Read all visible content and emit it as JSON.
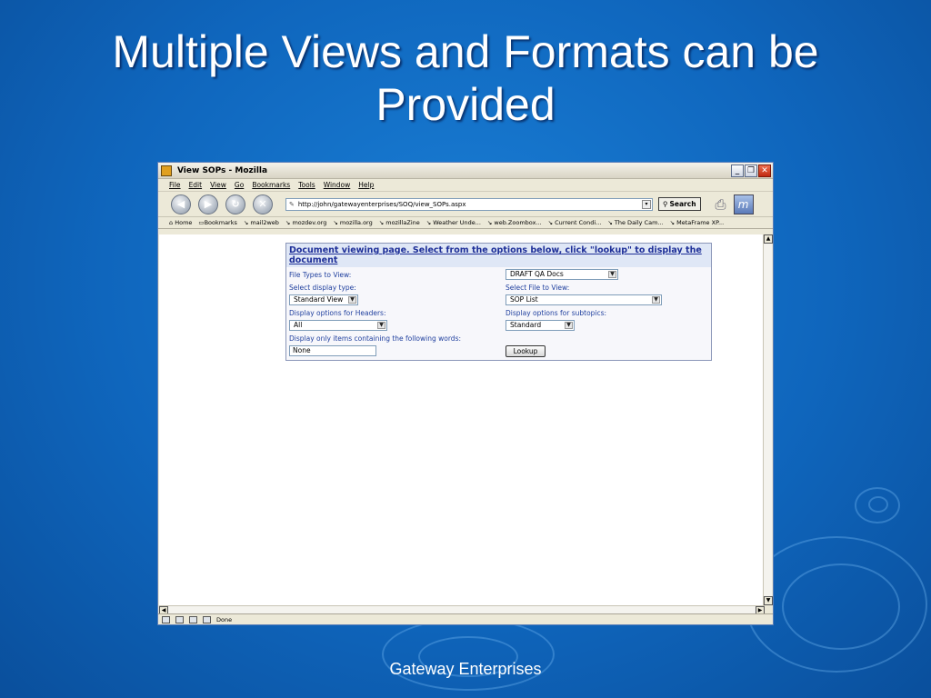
{
  "slide": {
    "title": "Multiple Views and Formats can be Provided",
    "footer": "Gateway Enterprises"
  },
  "window": {
    "title": "View SOPs - Mozilla",
    "menu": [
      "File",
      "Edit",
      "View",
      "Go",
      "Bookmarks",
      "Tools",
      "Window",
      "Help"
    ],
    "url": "http://john/gatewayenterprises/SOQ/view_SOPs.aspx",
    "search_label": "Search",
    "bookmarks": [
      "Home",
      "Bookmarks",
      "mail2web",
      "mozdev.org",
      "mozilla.org",
      "mozillaZine",
      "Weather Unde...",
      "web.Zoombox...",
      "Current Condi...",
      "The Daily Cam...",
      "MetaFrame XP..."
    ],
    "status": "Done"
  },
  "form": {
    "heading": "Document viewing page. Select from the options below, click \"lookup\" to display the document",
    "file_types_label": "File Types to View:",
    "file_types_value": "DRAFT QA Docs",
    "display_type_label": "Select display type:",
    "display_type_value": "Standard View",
    "select_file_label": "Select File to View:",
    "select_file_value": "SOP List",
    "headers_label": "Display options for Headers:",
    "headers_value": "All",
    "subtopics_label": "Display options for subtopics:",
    "subtopics_value": "Standard",
    "words_label": "Display only items containing the following words:",
    "words_value": "None",
    "lookup_label": "Lookup"
  },
  "colors": {
    "background": "#0f66bd",
    "form_text": "#1f3f9e",
    "heading": "#1e2f98"
  }
}
